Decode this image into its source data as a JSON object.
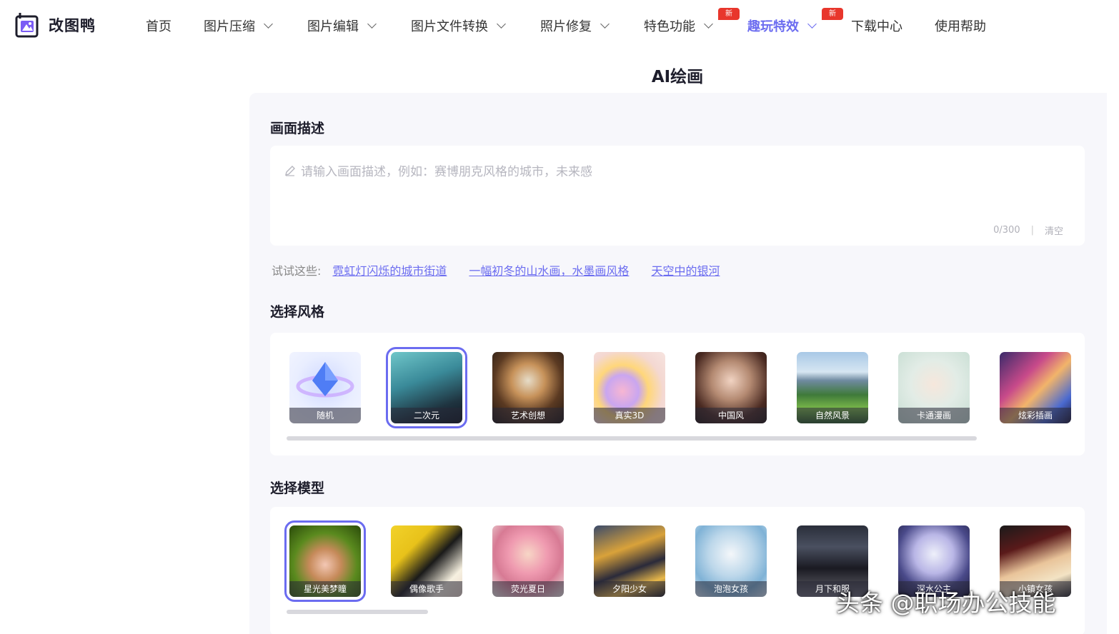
{
  "brand": {
    "name": "改图鸭"
  },
  "nav": {
    "items": [
      {
        "label": "首页",
        "dropdown": false,
        "active": false,
        "badge": ""
      },
      {
        "label": "图片压缩",
        "dropdown": true,
        "active": false,
        "badge": ""
      },
      {
        "label": "图片编辑",
        "dropdown": true,
        "active": false,
        "badge": ""
      },
      {
        "label": "图片文件转换",
        "dropdown": true,
        "active": false,
        "badge": ""
      },
      {
        "label": "照片修复",
        "dropdown": true,
        "active": false,
        "badge": ""
      },
      {
        "label": "特色功能",
        "dropdown": true,
        "active": false,
        "badge": "新"
      },
      {
        "label": "趣玩特效",
        "dropdown": true,
        "active": true,
        "badge": "新"
      },
      {
        "label": "下载中心",
        "dropdown": false,
        "active": false,
        "badge": ""
      },
      {
        "label": "使用帮助",
        "dropdown": false,
        "active": false,
        "badge": ""
      }
    ]
  },
  "page": {
    "title": "AI绘画"
  },
  "description": {
    "section_title": "画面描述",
    "placeholder": "请输入画面描述，例如：赛博朋克风格的城市，未来感",
    "counter": "0/300",
    "clear_label": "清空"
  },
  "try_these": {
    "label": "试试这些:",
    "links": [
      "霓虹灯闪烁的城市街道",
      "一幅初冬的山水画，水墨画风格",
      "天空中的银河"
    ]
  },
  "styles": {
    "section_title": "选择风格",
    "selected": "二次元",
    "items": [
      "随机",
      "二次元",
      "艺术创想",
      "真实3D",
      "中国风",
      "自然风景",
      "卡通漫画",
      "炫彩插画"
    ]
  },
  "models": {
    "section_title": "选择模型",
    "selected": "星光美梦瞳",
    "items": [
      "星光美梦瞳",
      "偶像歌手",
      "荧光夏日",
      "夕阳少女",
      "泡泡女孩",
      "月下和服",
      "深水公主",
      "小镇女孩"
    ]
  },
  "watermark": {
    "text": "头条 @职场办公技能"
  },
  "colors": {
    "accent": "#6b6cf0",
    "badge": "#e8362c",
    "panel_bg": "#f7f7fb"
  }
}
